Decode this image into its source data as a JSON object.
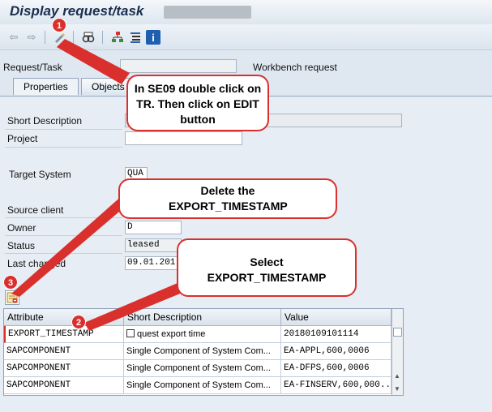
{
  "window": {
    "title": "Display request/task"
  },
  "toolbar": {
    "back_icon": "back-arrow-icon",
    "forward_icon": "forward-arrow-icon",
    "edit_icon": "display-change-icon",
    "glasses_icon": "display-object-icon",
    "hierarchy_icon": "hierarchy-icon",
    "list_icon": "list-icon",
    "info_icon": "info-icon",
    "info_glyph": "i"
  },
  "header": {
    "request_label": "Request/Task",
    "request_type": "Workbench request"
  },
  "tabs": [
    {
      "label": "Properties"
    },
    {
      "label": "Objects"
    }
  ],
  "properties": {
    "short_description_label": "Short Description",
    "project_label": "Project",
    "target_system_label": "Target System",
    "target_system_value": "QUA",
    "source_client_label": "Source client",
    "owner_label": "Owner",
    "owner_value": "D",
    "status_label": "Status",
    "status_value": "leased",
    "last_changed_label": "Last changed",
    "last_changed_value": "09.01.201"
  },
  "attributes_table": {
    "columns": [
      "Attribute",
      "Short Description",
      "Value"
    ],
    "rows": [
      {
        "attribute": "EXPORT_TIMESTAMP",
        "short_description": "quest export time",
        "value": "20180109101114"
      },
      {
        "attribute": "SAPCOMPONENT",
        "short_description": "Single Component of System Com...",
        "value": "EA-APPL,600,0006"
      },
      {
        "attribute": "SAPCOMPONENT",
        "short_description": "Single Component of System Com...",
        "value": "EA-DFPS,600,0006"
      },
      {
        "attribute": "SAPCOMPONENT",
        "short_description": "Single Component of System Com...",
        "value": "EA-FINSERV,600,000..."
      }
    ]
  },
  "callouts": {
    "edit": "In SE09 double click on TR. Then click on EDIT button",
    "delete": "Delete the EXPORT_TIMESTAMP",
    "select": "Select EXPORT_TIMESTAMP"
  },
  "badges": {
    "one": "1",
    "two": "2",
    "three": "3"
  },
  "colors": {
    "annotation_red": "#d9302d",
    "title_blue": "#1b2e4f"
  }
}
